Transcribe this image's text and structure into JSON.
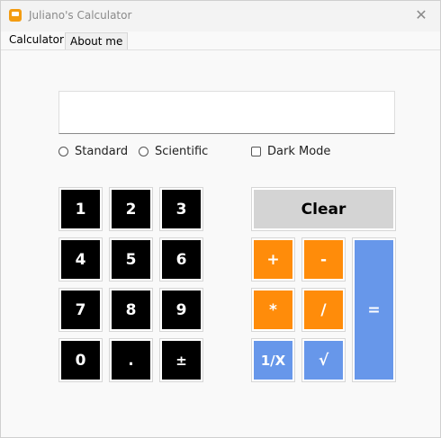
{
  "window": {
    "title": "Juliano's Calculator",
    "close_glyph": "✕"
  },
  "tabs": [
    {
      "label": "Calculator"
    },
    {
      "label": "About me"
    }
  ],
  "display": {
    "value": ""
  },
  "modes": {
    "standard": "Standard",
    "scientific": "Scientific",
    "dark_mode": "Dark Mode"
  },
  "keys": {
    "k1": "1",
    "k2": "2",
    "k3": "3",
    "k4": "4",
    "k5": "5",
    "k6": "6",
    "k7": "7",
    "k8": "8",
    "k9": "9",
    "k0": "0",
    "dot": ".",
    "sign": "±",
    "clear": "Clear",
    "plus": "+",
    "minus": "-",
    "times": "*",
    "divide": "/",
    "equals": "=",
    "reciprocal": "1/X",
    "sqrt": "√"
  },
  "colors": {
    "number": "#000000",
    "operator": "#ff8c0a",
    "function": "#6797ea",
    "clear": "#d4d4d4"
  }
}
